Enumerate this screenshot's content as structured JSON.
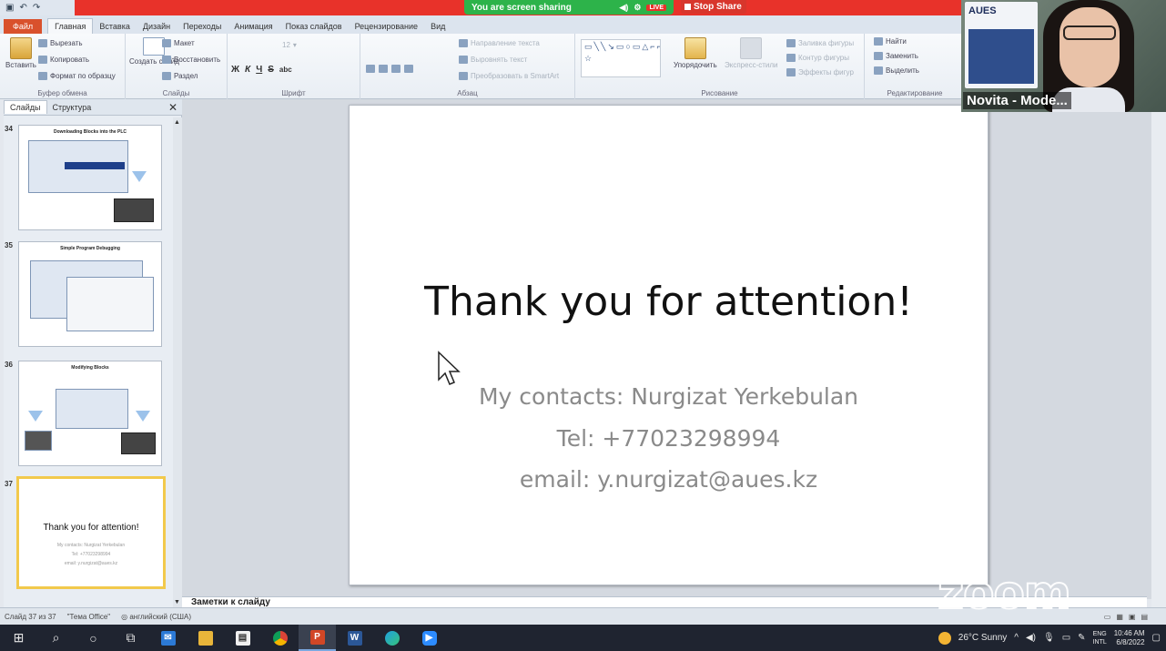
{
  "zoom": {
    "sharing_label": "You are screen sharing",
    "live_label": "LIVE",
    "stop_share_label": "Stop Share",
    "watermark": "zoom",
    "participant_name": "Novita - Mode...",
    "video_logo": "AUES"
  },
  "ribbon": {
    "tabs": [
      "Файл",
      "Главная",
      "Вставка",
      "Дизайн",
      "Переходы",
      "Анимация",
      "Показ слайдов",
      "Рецензирование",
      "Вид"
    ],
    "clipboard": {
      "paste": "Вставить",
      "cut": "Вырезать",
      "copy": "Копировать",
      "format": "Формат по образцу",
      "label": "Буфер обмена"
    },
    "slides": {
      "new": "Создать слайд",
      "layout": "Макет",
      "reset": "Восстановить",
      "section": "Раздел",
      "label": "Слайды"
    },
    "font": {
      "size": "12",
      "bold": "Ж",
      "italic": "К",
      "underline": "Ч",
      "strike": "S",
      "shadow": "abc",
      "label": "Шрифт"
    },
    "paragraph": {
      "direction": "Направление текста",
      "align": "Выровнять текст",
      "smartart": "Преобразовать в SmartArt",
      "label": "Абзац"
    },
    "drawing": {
      "arrange": "Упорядочить",
      "styles": "Экспресс-стили",
      "fill": "Заливка фигуры",
      "outline": "Контур фигуры",
      "effects": "Эффекты фигур",
      "label": "Рисование"
    },
    "editing": {
      "find": "Найти",
      "replace": "Заменить",
      "select": "Выделить",
      "label": "Редактирование"
    }
  },
  "panel": {
    "tabs": [
      "Слайды",
      "Структура"
    ],
    "thumbs": [
      {
        "num": "34",
        "title": "Downloading Blocks into the PLC"
      },
      {
        "num": "35",
        "title": "Simple Program Debugging"
      },
      {
        "num": "36",
        "title": "Modifying Blocks"
      },
      {
        "num": "37",
        "title": "Thank you for attention!",
        "lines": [
          "My contacts: Nurgizat Yerkebulan",
          "Tel: +77023298994",
          "email: y.nurgizat@aues.kz"
        ]
      }
    ]
  },
  "slide": {
    "title": "Thank you for attention!",
    "contacts": "My contacts: Nurgizat Yerkebulan",
    "tel": "Tel: +77023298994",
    "email": "email: y.nurgizat@aues.kz"
  },
  "notes_placeholder": "Заметки к слайду",
  "status": {
    "slide_counter": "Слайд 37 из 37",
    "theme": "\"Тема Office\"",
    "language": "английский (США)"
  },
  "taskbar": {
    "weather_temp": "26°C",
    "weather_desc": "Sunny",
    "lang_top": "ENG",
    "lang_bottom": "INTL",
    "time": "10:46 AM",
    "date": "6/8/2022"
  }
}
